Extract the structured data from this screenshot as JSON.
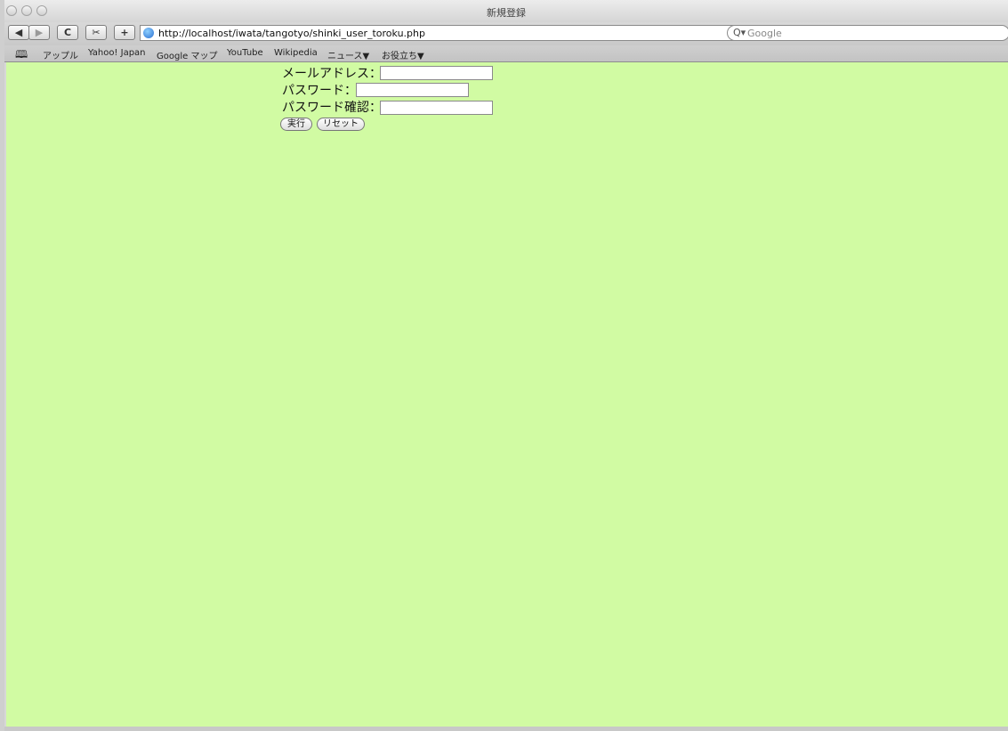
{
  "window": {
    "title": "新規登録"
  },
  "toolbar": {
    "url": "http://localhost/iwata/tangotyo/shinki_user_toroku.php",
    "search_placeholder": "Google",
    "back_icon": "◀",
    "forward_icon": "▶",
    "reload_icon": "C",
    "add_icon": "+"
  },
  "bookmarks": {
    "items": [
      "アップル",
      "Yahoo! Japan",
      "Google マップ",
      "YouTube",
      "Wikipedia",
      "ニュース▼",
      "お役立ち▼"
    ]
  },
  "form": {
    "email_label": "メールアドレス：",
    "password_label": "パスワード：",
    "password_confirm_label": "パスワード確認：",
    "email_value": "",
    "password_value": "",
    "password_confirm_value": "",
    "submit_label": "実行",
    "reset_label": "リセット"
  },
  "colors": {
    "page_background": "#d1fba3"
  }
}
